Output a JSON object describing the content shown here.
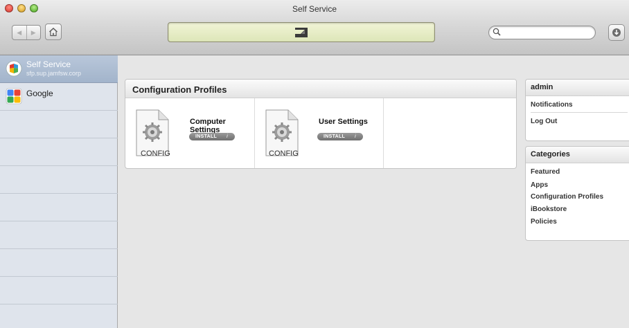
{
  "window": {
    "title": "Self Service"
  },
  "toolbar": {
    "back_label": "◀",
    "forward_label": "▶",
    "search": {
      "value": "",
      "placeholder": ""
    }
  },
  "sidebar": {
    "items": [
      {
        "name": "Self Service",
        "sub": "sfp.sup.jamfsw.corp",
        "icon": "self-service-icon",
        "selected": true
      },
      {
        "name": "Google",
        "sub": "",
        "icon": "google-icon",
        "selected": false
      }
    ]
  },
  "main": {
    "section_title": "Configuration Profiles",
    "items": [
      {
        "title": "Computer Settings",
        "badge": "CONFIG",
        "install_label": "INSTALL",
        "info": "i"
      },
      {
        "title": "User Settings",
        "badge": "CONFIG",
        "install_label": "INSTALL",
        "info": "i"
      }
    ]
  },
  "user_panel": {
    "title": "admin",
    "links": [
      "Notifications",
      "Log Out"
    ]
  },
  "categories": {
    "title": "Categories",
    "links": [
      "Featured",
      "Apps",
      "Configuration Profiles",
      "iBookstore",
      "Policies"
    ]
  },
  "colors": {
    "sidebar_bg": "#dfe4ec",
    "sidebar_selected": "#a2b4cb",
    "lcd": "#e8eec8",
    "content_bg": "#e6e6e6"
  }
}
